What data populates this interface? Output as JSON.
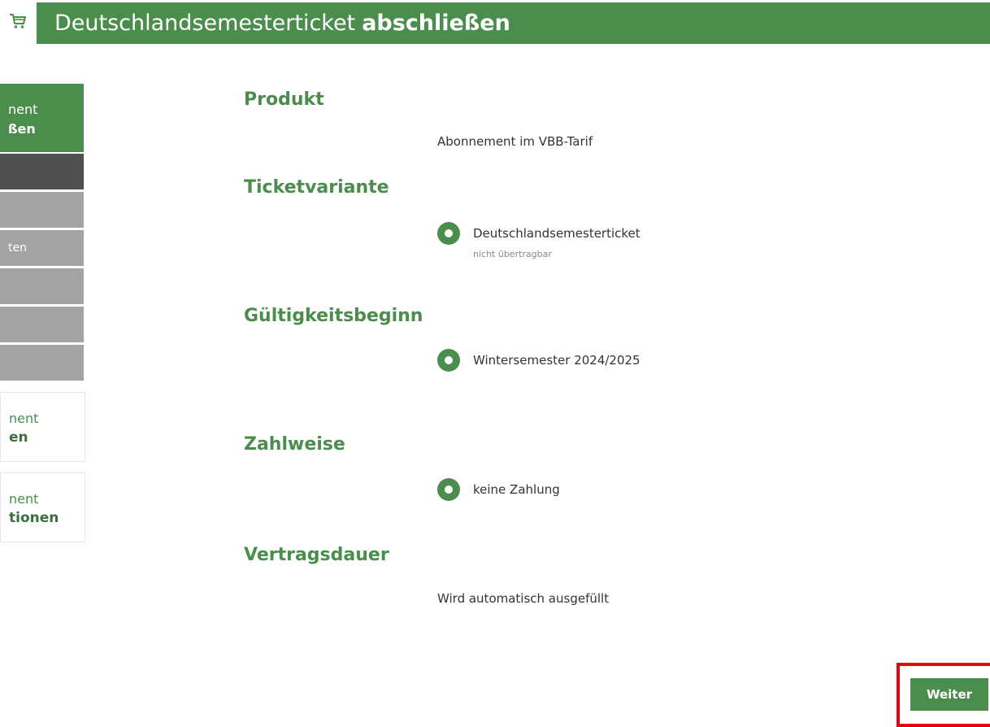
{
  "header": {
    "title_regular": "Deutschlandsemesterticket",
    "title_bold": "abschließen",
    "cart_icon": "cart-icon"
  },
  "sidebar": {
    "active": {
      "line1": "nent",
      "line2": "ßen"
    },
    "grey_item_text": "ten",
    "white_items": [
      {
        "line1": "nent",
        "line2": "en"
      },
      {
        "line1": "nent",
        "line2": "tionen"
      }
    ]
  },
  "sections": {
    "produkt": {
      "title": "Produkt",
      "value": "Abonnement im VBB-Tarif"
    },
    "ticketvariante": {
      "title": "Ticketvariante",
      "option": "Deutschlandsemesterticket",
      "note": "nicht übertragbar"
    },
    "gueltigkeit": {
      "title": "Gültigkeitsbeginn",
      "option": "Wintersemester 2024/2025"
    },
    "zahlweise": {
      "title": "Zahlweise",
      "option": "keine Zahlung"
    },
    "vertragsdauer": {
      "title": "Vertragsdauer",
      "value": "Wird automatisch ausgefüllt"
    }
  },
  "footer": {
    "next_label": "Weiter"
  },
  "colors": {
    "brand_green": "#4a8d4d",
    "highlight_red": "#e8000f",
    "sidebar_dark": "#505050",
    "sidebar_grey": "#a3a3a3"
  }
}
